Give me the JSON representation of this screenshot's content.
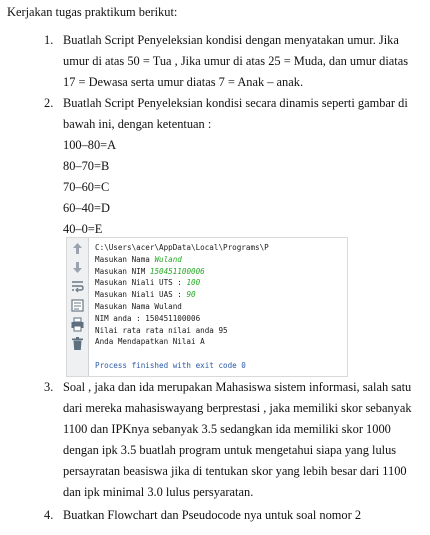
{
  "intro": "Kerjakan tugas praktikum berikut:",
  "items": [
    {
      "number": "1.",
      "lines": [
        "Buatlah Script Penyeleksian kondisi dengan menyatakan umur. Jika",
        "umur di atas 50 = Tua , Jika umur di atas 25 = Muda, dan umur diatas",
        "17 = Dewasa serta umur diatas 7 = Anak – anak."
      ]
    },
    {
      "number": "2.",
      "lines": [
        "Buatlah Script Penyeleksian kondisi secara dinamis seperti gambar di",
        "bawah ini, dengan ketentuan :"
      ],
      "grades": [
        "100–80=A",
        "80–70=B",
        "70–60=C",
        "60–40=D",
        "40–0=E"
      ]
    },
    {
      "number": "3.",
      "lines": [
        "Soal , jaka dan ida merupakan Mahasiswa sistem informasi, salah satu",
        "dari mereka mahasiswayang berprestasi , jaka memiliki skor sebanyak",
        "1100 dan IPKnya sebanyak 3.5 sedangkan ida memiliki skor 1000",
        "dengan ipk 3.5 buatlah program untuk mengetahui siapa yang lulus",
        "persayratan beasiswa jika di tentukan skor yang lebih besar dari 1100",
        "dan ipk minimal 3.0 lulus persyaratan."
      ]
    },
    {
      "number": "4.",
      "lines": [
        "Buatkan Flowchart dan Pseudocode nya untuk soal nomor 2"
      ]
    }
  ],
  "console": {
    "path": "C:\\Users\\acer\\AppData\\Local\\Programs\\P",
    "prompt_name": "Masukan Nama ",
    "value_name": "Wuland",
    "prompt_nim": "Masukan NIM ",
    "value_nim": "150451100006",
    "prompt_uts": "Masukan Niali UTS : ",
    "value_uts": "100",
    "prompt_uas": "Masukan Niali UAS : ",
    "value_uas": "90",
    "echo_name": "Masukan Nama Wuland",
    "nim_line": "NIM anda : 150451100006",
    "avg_line": "Nilai rata rata nilai anda 95",
    "grade_line": "Anda Mendapatkan Nilai A",
    "exit_line": "Process finished with exit code 0"
  },
  "icons": [
    "arrow-up-icon",
    "arrow-down-icon",
    "wrap-icon",
    "scroll-icon",
    "print-icon",
    "trash-icon"
  ]
}
